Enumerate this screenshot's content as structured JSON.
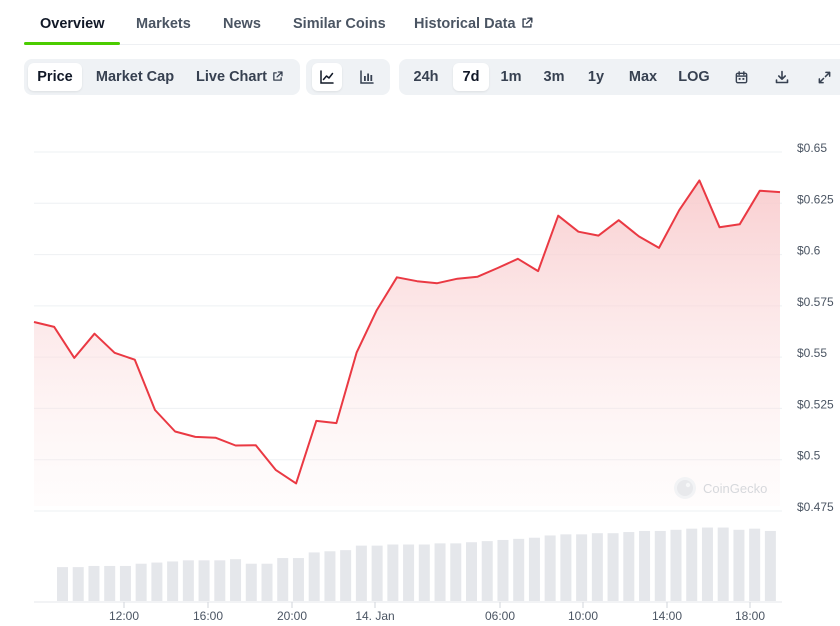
{
  "tabs": [
    {
      "label": "Overview",
      "active": true
    },
    {
      "label": "Markets",
      "active": false
    },
    {
      "label": "News",
      "active": false
    },
    {
      "label": "Similar Coins",
      "active": false
    },
    {
      "label": "Historical Data",
      "active": false,
      "external": true
    }
  ],
  "toolbar": {
    "view_buttons": [
      "Price",
      "Market Cap",
      "Live Chart"
    ],
    "selected_view": "Price",
    "chart_style_icons": [
      "line-chart-icon",
      "candlestick-chart-icon"
    ],
    "selected_style": "line-chart-icon",
    "ranges": [
      "24h",
      "7d",
      "1m",
      "3m",
      "1y",
      "Max",
      "LOG"
    ],
    "selected_range": "7d",
    "action_icons": [
      "calendar-icon",
      "download-icon",
      "fullscreen-icon"
    ]
  },
  "watermark": "CoinGecko",
  "colors": {
    "line": "#ea3943",
    "area_top": "#f8c9cb",
    "volume_bar": "#e5e7eb",
    "grid": "#eef0f3",
    "active_tab_underline": "#4bcc00"
  },
  "chart_data": {
    "type": "area",
    "x_tick_labels": [
      "12:00",
      "16:00",
      "20:00",
      "14. Jan",
      "06:00",
      "10:00",
      "14:00",
      "18:00"
    ],
    "y_tick_labels": [
      "$0.65",
      "$0.625",
      "$0.6",
      "$0.575",
      "$0.55",
      "$0.525",
      "$0.5",
      "$0.475"
    ],
    "ylim": [
      0.475,
      0.65
    ],
    "grid": true,
    "price_series": {
      "values": [
        0.5647,
        0.5623,
        0.5472,
        0.559,
        0.5497,
        0.5463,
        0.5218,
        0.5113,
        0.5087,
        0.5083,
        0.5045,
        0.5046,
        0.4925,
        0.486,
        0.5165,
        0.5154,
        0.5498,
        0.5705,
        0.5865,
        0.5846,
        0.5836,
        0.5858,
        0.5868,
        0.591,
        0.5955,
        0.5895,
        0.6165,
        0.6087,
        0.6068,
        0.6143,
        0.6064,
        0.6008,
        0.6192,
        0.6337,
        0.6109,
        0.6123,
        0.6287,
        0.628
      ]
    },
    "volume_series": {
      "values": [
        30,
        30,
        31,
        31,
        31,
        33,
        34,
        35,
        36,
        36,
        36,
        37,
        33,
        33,
        38,
        38,
        43,
        44,
        45,
        49,
        49,
        50,
        50,
        50,
        51,
        51,
        52,
        53,
        54,
        55,
        56,
        58,
        59,
        59,
        60,
        60,
        61,
        62,
        62,
        63,
        64,
        65,
        65,
        63,
        64,
        62,
        64
      ]
    }
  }
}
